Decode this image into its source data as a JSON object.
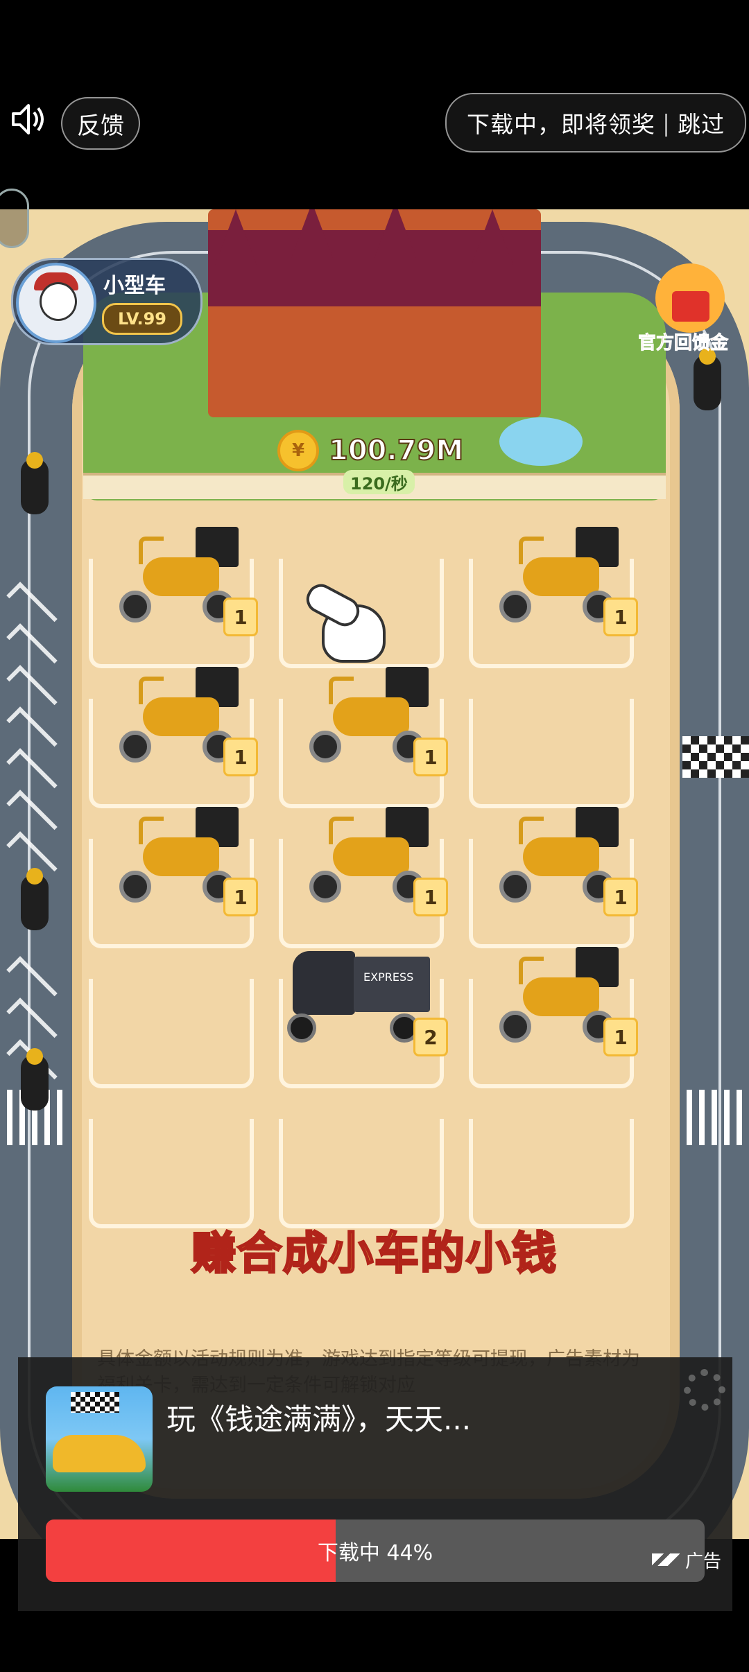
{
  "topbar": {
    "speaker_icon": "speaker-icon",
    "feedback_label": "反馈",
    "skip_status": "下载中，即将领奖",
    "skip_label": "跳过"
  },
  "game": {
    "player": {
      "car_type": "小型车",
      "level": "LV.99"
    },
    "coins": {
      "symbol": "¥",
      "value": "100.79M",
      "rate": "120/秒"
    },
    "gift_label": "官方回馈金",
    "slogan": "赚合成小车的小钱",
    "rules_text": "具体金额以活动规则为准，游戏达到指定等级可提现，广告素材为福利关卡，需达到一定条件可解锁对应",
    "slots": [
      {
        "vehicle": "scooter",
        "level": "1"
      },
      {
        "vehicle": "",
        "level": ""
      },
      {
        "vehicle": "scooter",
        "level": "1"
      },
      {
        "vehicle": "scooter",
        "level": "1"
      },
      {
        "vehicle": "scooter",
        "level": "1"
      },
      {
        "vehicle": "",
        "level": ""
      },
      {
        "vehicle": "scooter",
        "level": "1"
      },
      {
        "vehicle": "scooter",
        "level": "1"
      },
      {
        "vehicle": "scooter",
        "level": "1"
      },
      {
        "vehicle": "",
        "level": ""
      },
      {
        "vehicle": "tricycle",
        "level": "2",
        "logo": "EXPRESS"
      },
      {
        "vehicle": "scooter",
        "level": "1"
      },
      {
        "vehicle": "",
        "level": ""
      },
      {
        "vehicle": "",
        "level": ""
      },
      {
        "vehicle": "",
        "level": ""
      }
    ]
  },
  "ad": {
    "title": "玩《钱途满满》，天天...",
    "progress_label": "下载中 44%",
    "progress_fraction": 0.44,
    "ad_label": "广告"
  },
  "colors": {
    "progress": "#f34040",
    "progress_track": "#595959",
    "slogan": "#ffe34a",
    "scooter": "#e3a21a"
  }
}
